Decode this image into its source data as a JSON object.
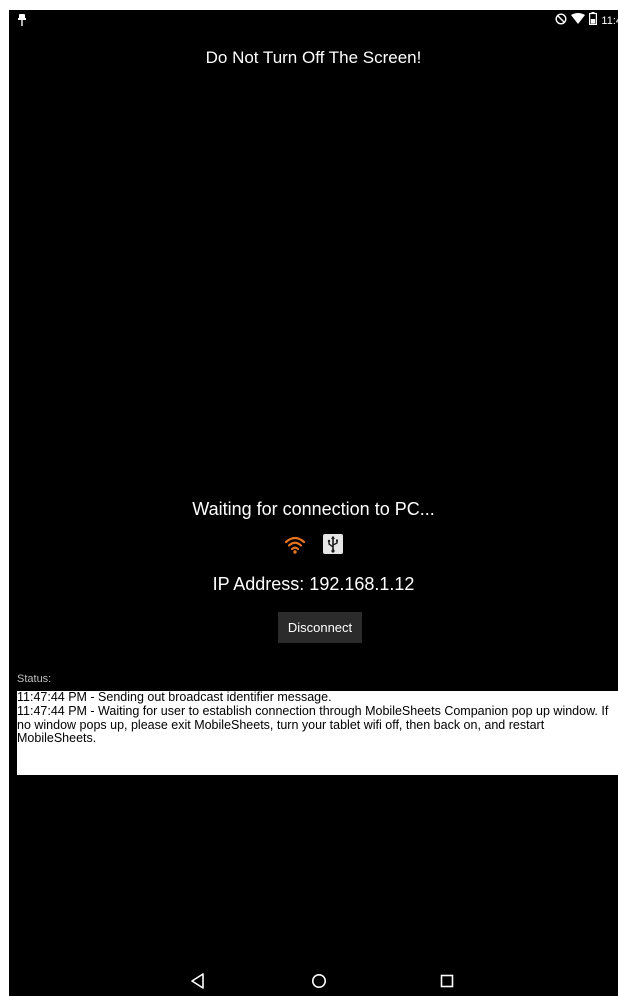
{
  "status_bar": {
    "time": "11:4",
    "icons": [
      "notification-pin-icon",
      "do-not-disturb-icon",
      "wifi-signal-icon",
      "battery-icon"
    ]
  },
  "main": {
    "warning": "Do Not Turn Off The Screen!",
    "waiting": "Waiting for connection to PC...",
    "connection_icons": [
      "wifi-icon",
      "usb-icon"
    ],
    "accent_color": "#e8731e",
    "ip_address": "IP Address: 192.168.1.12",
    "disconnect_label": "Disconnect"
  },
  "status": {
    "label": "Status:",
    "lines": [
      "11:47:44 PM - Sending out broadcast identifier message.",
      "11:47:44 PM - Waiting for user to establish connection through MobileSheets Companion pop up window. If no window pops up, please exit MobileSheets, turn your tablet wifi off, then back on, and restart MobileSheets."
    ]
  },
  "nav_bar": {
    "buttons": [
      "back-icon",
      "home-icon",
      "recents-icon"
    ]
  }
}
